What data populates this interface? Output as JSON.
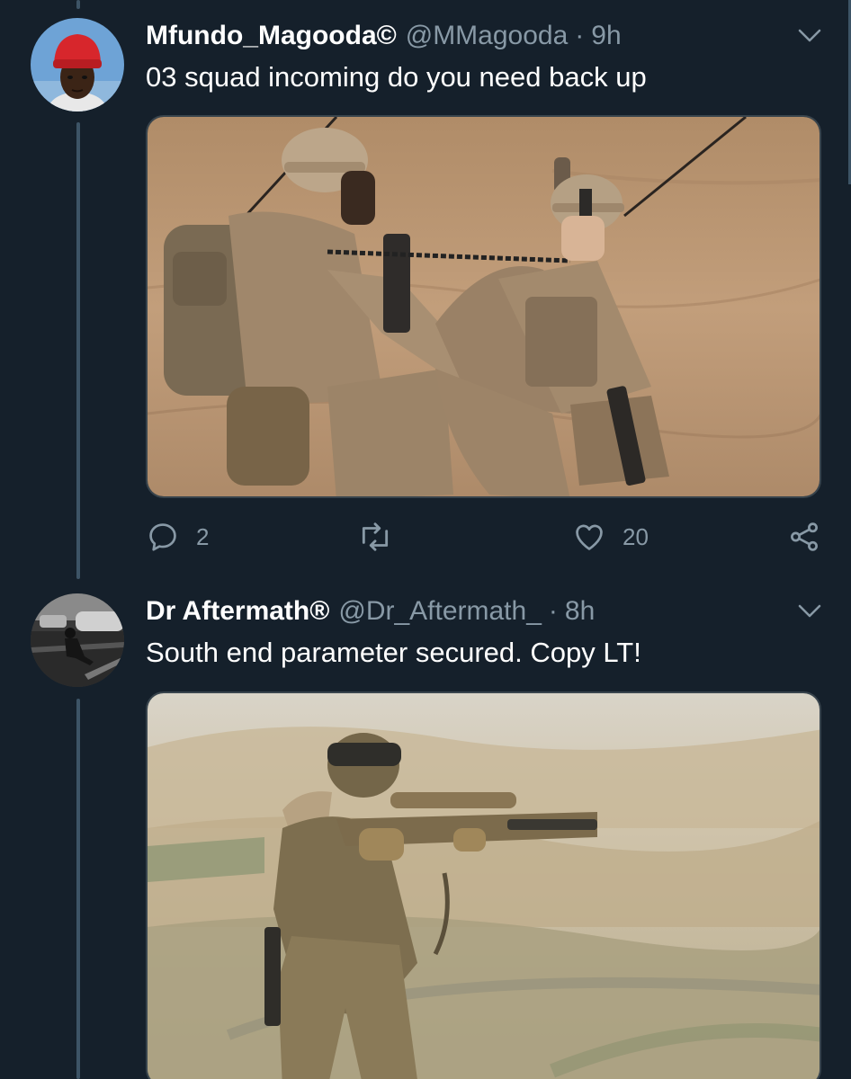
{
  "theme": {
    "background": "#15202b",
    "text": "#ffffff",
    "secondary_text": "#8899a6",
    "thread_line": "#3d5466",
    "border": "#38444d"
  },
  "tweets": [
    {
      "display_name": "Mfundo_Magooda©",
      "handle": "@MMagooda",
      "separator": "·",
      "time": "9h",
      "text": "03 squad incoming do you need back up",
      "avatar_icon": "avatar-red-beanie",
      "media_icon": "photo-soldiers-radio-desert",
      "actions": {
        "reply_count": "2",
        "retweet_count": "",
        "like_count": "20",
        "reply_icon": "reply-icon",
        "retweet_icon": "retweet-icon",
        "like_icon": "heart-icon",
        "share_icon": "share-icon"
      }
    },
    {
      "display_name": "Dr Aftermath®",
      "handle": "@Dr_Aftermath_",
      "separator": "·",
      "time": "8h",
      "text": "South end parameter secured. Copy LT!",
      "avatar_icon": "avatar-grayscale-street",
      "media_icon": "photo-soldier-rifle-hills"
    }
  ]
}
